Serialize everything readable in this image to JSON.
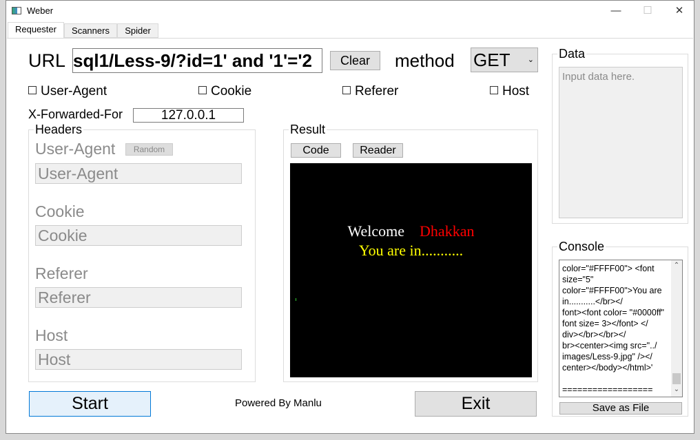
{
  "window": {
    "title": "Weber",
    "minimize": "—",
    "maximize": "☐",
    "close": "✕"
  },
  "tabs": [
    {
      "label": "Requester",
      "active": true
    },
    {
      "label": "Scanners"
    },
    {
      "label": "Spider"
    }
  ],
  "url": {
    "label": "URL",
    "value": "sql1/Less-9/?id=1' and '1'='2",
    "clear": "Clear"
  },
  "method": {
    "label": "method",
    "value": "GET"
  },
  "checkboxes": [
    {
      "label": "User-Agent",
      "checked": false
    },
    {
      "label": "Cookie",
      "checked": false
    },
    {
      "label": "Referer",
      "checked": false
    },
    {
      "label": "Host",
      "checked": false
    }
  ],
  "xff": {
    "label": "X-Forwarded-For",
    "value": "127.0.0.1"
  },
  "headers": {
    "title": "Headers",
    "random": "Random",
    "fields": [
      {
        "label": "User-Agent",
        "placeholder": "User-Agent"
      },
      {
        "label": "Cookie",
        "placeholder": "Cookie"
      },
      {
        "label": "Referer",
        "placeholder": "Referer"
      },
      {
        "label": "Host",
        "placeholder": "Host"
      }
    ]
  },
  "result": {
    "title": "Result",
    "code": "Code",
    "reader": "Reader",
    "welcome": "Welcome",
    "name": "Dhakkan",
    "message": "You are in...........",
    "colors": {
      "welcome": "#ffffff",
      "name": "#ff0000",
      "message": "#ffff00",
      "background": "#000000"
    }
  },
  "data": {
    "title": "Data",
    "placeholder": "Input data here."
  },
  "console": {
    "title": "Console",
    "lines": [
      "color=\"#FFFF00\"> <font",
      "size=\"5\"",
      "color=\"#FFFF00\">You are",
      "in...........</br></",
      "font><font color= \"#0000ff\"",
      "font size= 3></font> </",
      "div></br></br></",
      "br><center><img src=\"../",
      "images/Less-9.jpg\" /></",
      "center></body></html>'",
      "",
      "=================="
    ],
    "save": "Save as File"
  },
  "footer": {
    "start": "Start",
    "powered": "Powered By Manlu",
    "exit": "Exit"
  },
  "accent": "#0078d7"
}
